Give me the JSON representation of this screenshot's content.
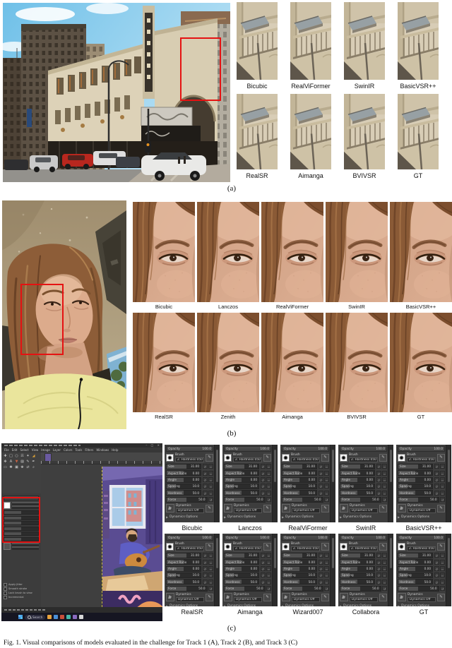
{
  "figure": {
    "caption": "Fig. 1. Visual comparisons of models evaluated in the challenge for Track 1 (A), Track 2 (B), and Track 3 (C)",
    "panel_a_label": "(a)",
    "panel_b_label": "(b)",
    "panel_c_label": "(c)"
  },
  "panel_a": {
    "row1": [
      "Bicubic",
      "RealViFormer",
      "SwinIR",
      "BasicVSR++"
    ],
    "row2": [
      "RealSR",
      "Aimanga",
      "BVIVSR",
      "GT"
    ]
  },
  "panel_b": {
    "row1": [
      "Bicubic",
      "Lanczos",
      "RealViFormer",
      "SwinIR",
      "BasicVSR++"
    ],
    "row2": [
      "RealSR",
      "Zenith",
      "Aimanga",
      "BVIVSR",
      "GT"
    ]
  },
  "panel_c": {
    "row1": [
      "Bicubic",
      "Lanczos",
      "RealViFormer",
      "SwinIR",
      "BasicVSR++"
    ],
    "row2": [
      "RealSR",
      "Aimanga",
      "Wizard007",
      "Collabora",
      "GT"
    ]
  },
  "gimp": {
    "menu": [
      "File",
      "Edit",
      "Select",
      "View",
      "Image",
      "Layer",
      "Colors",
      "Tools",
      "Filters",
      "Windows",
      "Help"
    ],
    "window_buttons": [
      "–",
      "□",
      "×"
    ],
    "tool_options": {
      "opacity_label": "Opacity",
      "opacity_value": "100.0",
      "brush_label": "Brush",
      "brush_name": "2. Hardness 050",
      "sliders": [
        {
          "label": "Size",
          "value": "31.00"
        },
        {
          "label": "Aspect Ratio",
          "value": "0.00"
        },
        {
          "label": "Angle",
          "value": "0.00"
        },
        {
          "label": "Spacing",
          "value": "10.0"
        },
        {
          "label": "Hardness",
          "value": "50.0"
        },
        {
          "label": "Force",
          "value": "50.0"
        }
      ],
      "dynamics_label": "Dynamics",
      "dynamics_value": "Dynamics Off",
      "dynamics_options_label": "Dynamics Options",
      "checkboxes": [
        "Apply Jitter",
        "Smooth stroke",
        "Lock brush to view",
        "Incremental"
      ]
    },
    "taskbar": {
      "search_label": "Search"
    }
  },
  "colors": {
    "highlight_box": "#e51212",
    "gimp_panel_bg": "#3d3d3d",
    "taskbar_bg": "#161622"
  }
}
